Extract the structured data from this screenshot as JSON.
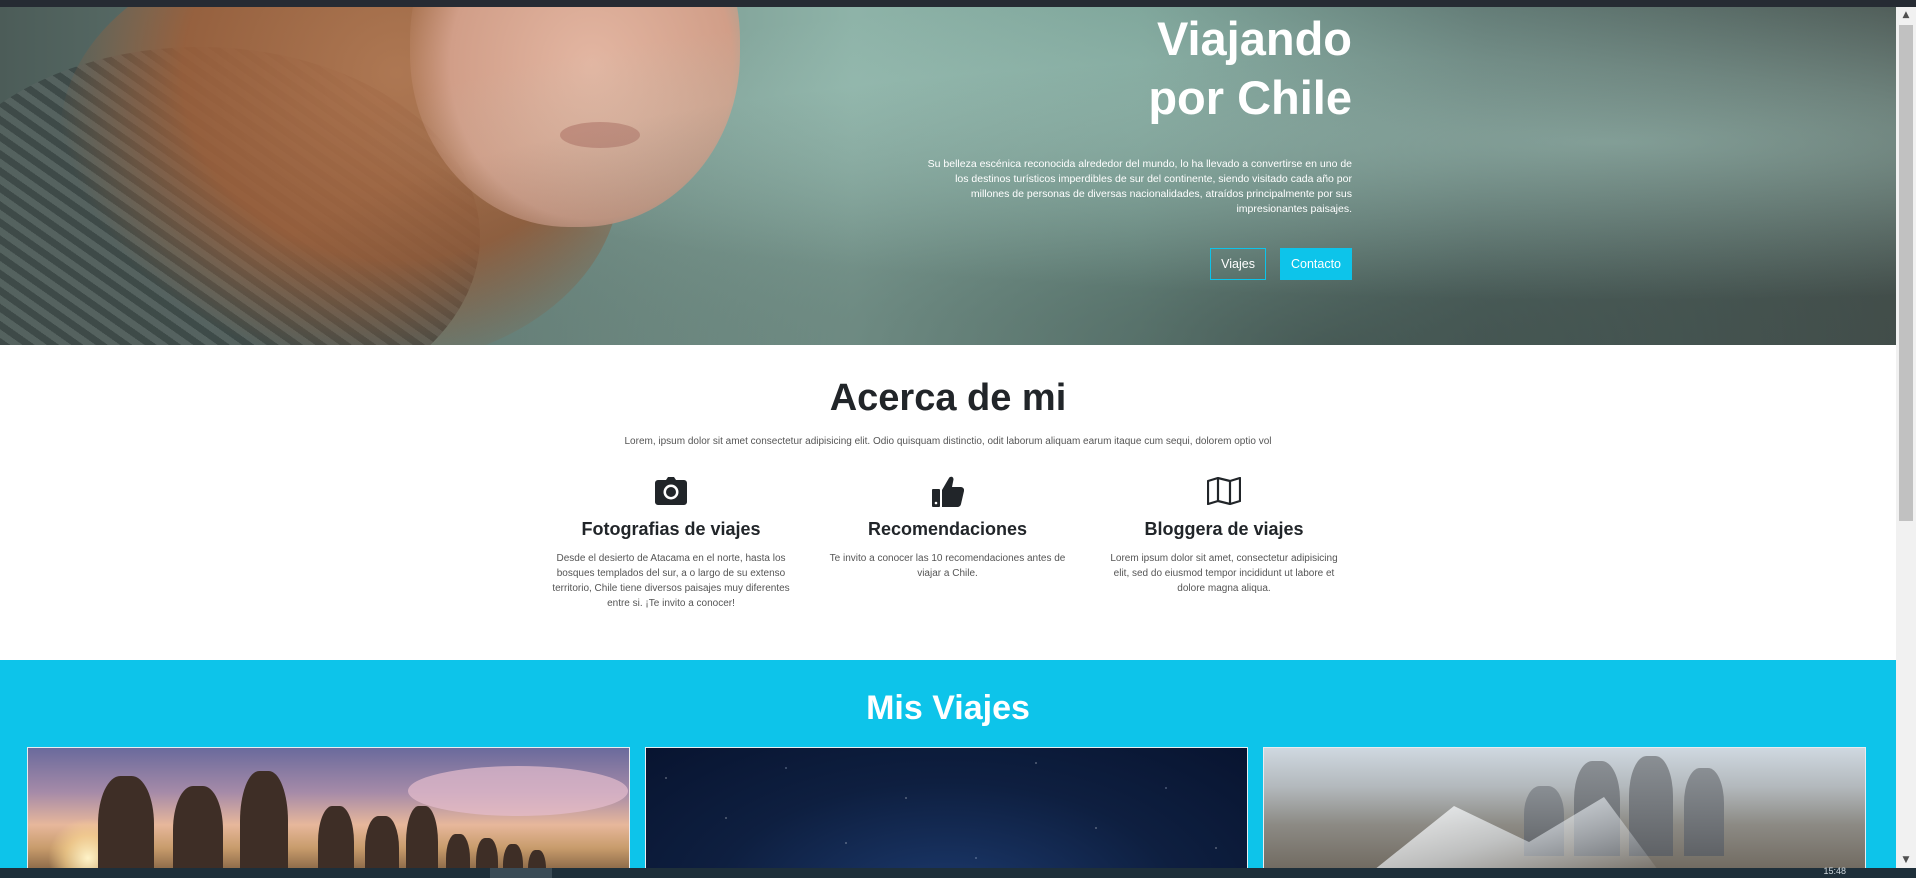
{
  "hero": {
    "title_line1": "Viajando",
    "title_line2": "por Chile",
    "text": "Su belleza escénica reconocida alrededor del mundo, lo ha llevado a convertirse en uno de los destinos turísticos imperdibles de sur del continente, siendo visitado cada año por millones de personas de diversas nacionalidades, atraídos principalmente por sus impresionantes paisajes.",
    "buttons": {
      "viajes": "Viajes",
      "contacto": "Contacto"
    }
  },
  "about": {
    "title": "Acerca de mi",
    "lead": "Lorem, ipsum dolor sit amet consectetur adipisicing elit. Odio quisquam distinctio, odit laborum aliquam earum itaque cum sequi, dolorem optio vol",
    "features": [
      {
        "icon": "camera-icon",
        "title": "Fotografias de viajes",
        "text": "Desde el desierto de Atacama en el norte, hasta los bosques templados del sur, a o largo de su extenso territorio, Chile tiene diversos paisajes muy diferentes entre si. ¡Te invito a conocer!"
      },
      {
        "icon": "thumbs-up-icon",
        "title": "Recomendaciones",
        "text": "Te invito a conocer las 10 recomendaciones antes de viajar a Chile."
      },
      {
        "icon": "map-icon",
        "title": "Bloggera de viajes",
        "text": "Lorem ipsum dolor sit amet, consectetur adipisicing elit, sed do eiusmod tempor incididunt ut labore et dolore magna aliqua."
      }
    ]
  },
  "viajes": {
    "title": "Mis Viajes"
  },
  "taskbar": {
    "clock": "15:48"
  },
  "colors": {
    "accent": "#0dc4ea",
    "heading": "#212529",
    "hero_text": "#ffffff"
  }
}
